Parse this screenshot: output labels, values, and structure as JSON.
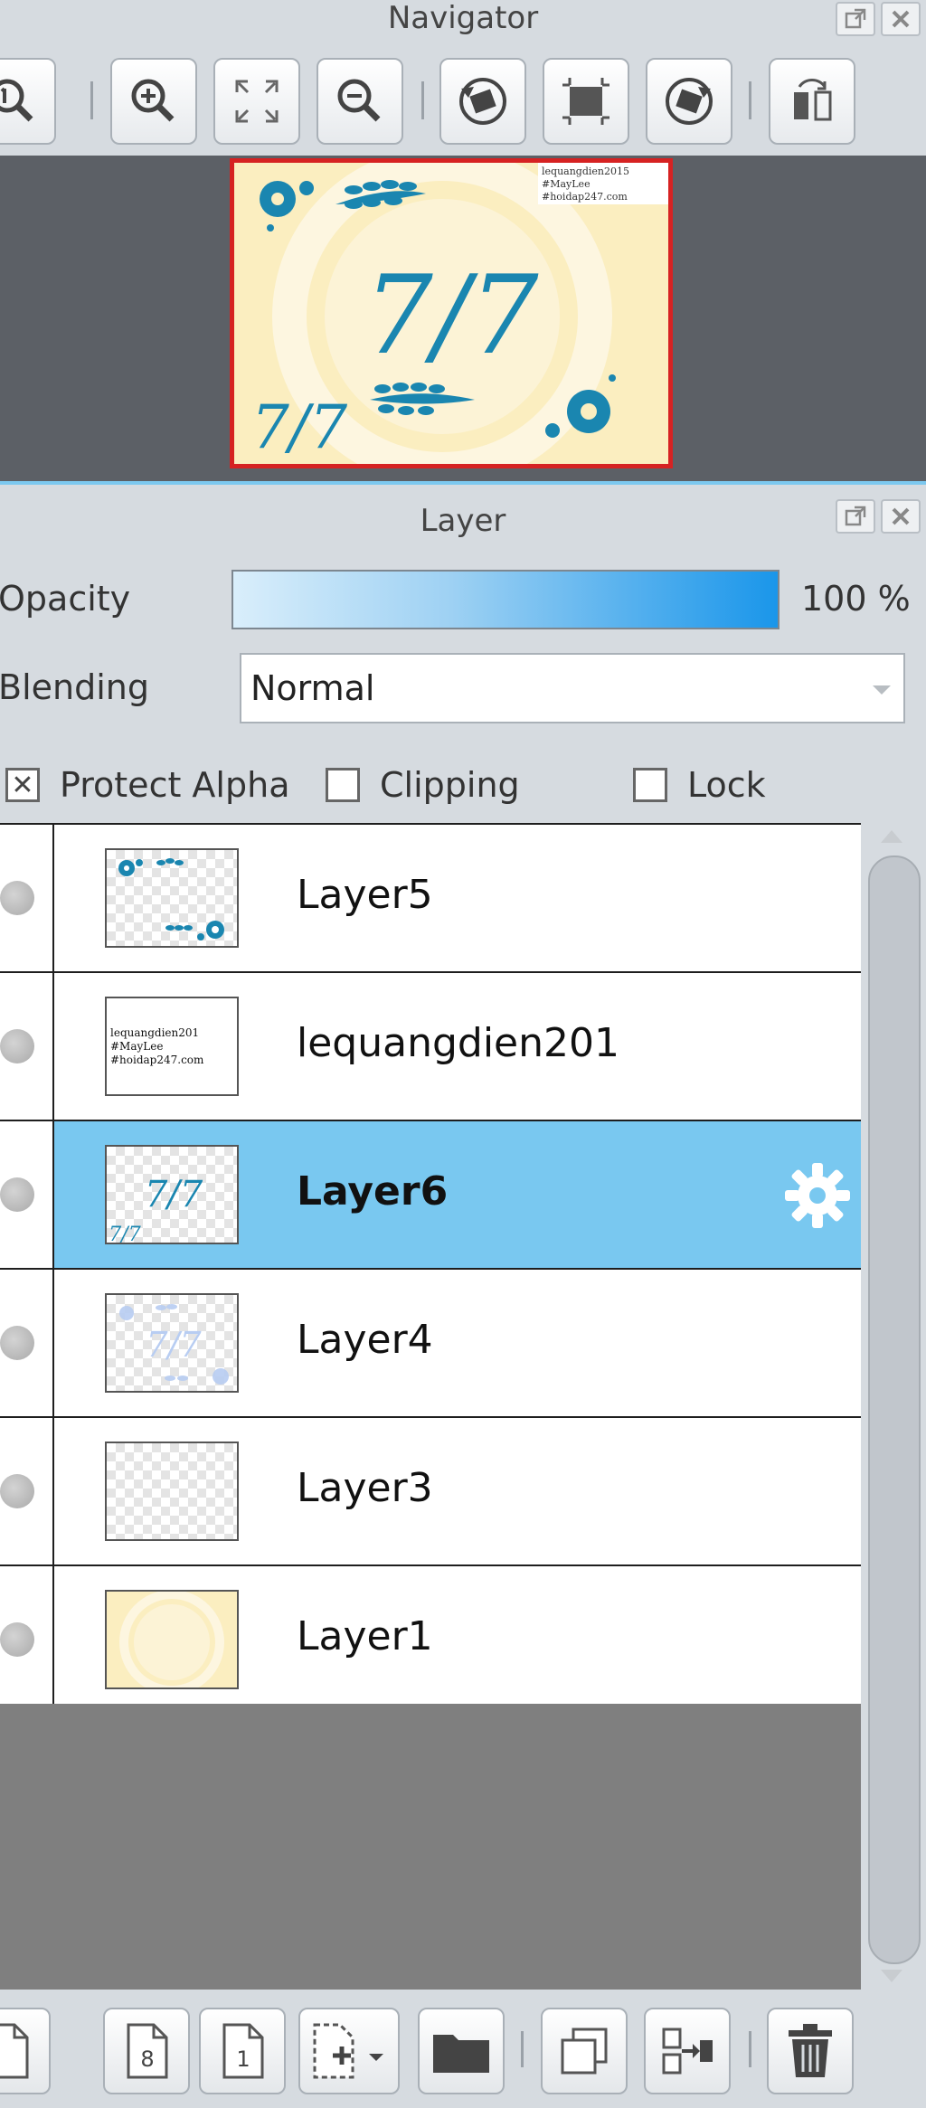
{
  "navigator": {
    "title": "Navigator",
    "preview_text": "7/7",
    "preview_small_text": "7/7",
    "preview_watermark": [
      "lequangdien2015",
      "#MayLee",
      "#hoidap247.com"
    ],
    "toolbar": [
      {
        "icon": "zoom-actual-icon"
      },
      {
        "icon": "zoom-in-icon"
      },
      {
        "icon": "fit-to-window-icon"
      },
      {
        "icon": "zoom-out-icon"
      },
      {
        "icon": "rotate-left-icon"
      },
      {
        "icon": "reset-view-icon"
      },
      {
        "icon": "rotate-right-icon"
      },
      {
        "icon": "flip-horizontal-icon"
      }
    ]
  },
  "layer_panel": {
    "title": "Layer",
    "opacity_label": "Opacity",
    "opacity_value": "100 %",
    "opacity_fraction": 1.0,
    "blending_label": "Blending",
    "blending_value": "Normal",
    "protect_alpha_label": "Protect Alpha",
    "protect_alpha_checked": true,
    "protect_alpha_mark": "✕",
    "clipping_label": "Clipping",
    "clipping_checked": false,
    "lock_label": "Lock",
    "lock_checked": false,
    "layers": [
      {
        "name": "Layer5",
        "selected": false
      },
      {
        "name": "lequangdien201",
        "selected": false,
        "thumb_text": [
          "lequangdien201",
          "#MayLee",
          "#hoidap247.com"
        ]
      },
      {
        "name": "Layer6",
        "selected": true,
        "thumb_text": "7/7"
      },
      {
        "name": "Layer4",
        "selected": false,
        "thumb_text": "7/7"
      },
      {
        "name": "Layer3",
        "selected": false
      },
      {
        "name": "Layer1",
        "selected": false
      }
    ],
    "bottom_toolbar": [
      {
        "icon": "new-layer-icon"
      },
      {
        "icon": "new-8bit-layer-icon",
        "label": "8"
      },
      {
        "icon": "new-1bit-layer-icon",
        "label": "1"
      },
      {
        "icon": "add-layer-dropdown-icon"
      },
      {
        "icon": "new-folder-icon"
      },
      {
        "icon": "duplicate-layer-icon"
      },
      {
        "icon": "merge-layer-icon"
      },
      {
        "icon": "delete-layer-icon"
      }
    ]
  },
  "colors": {
    "accent_blue": "#1a96ea",
    "selected_row": "#79c8f0",
    "preview_border": "#d62222",
    "preview_teal": "#1a86b0",
    "preview_cream": "#fbeec0"
  }
}
